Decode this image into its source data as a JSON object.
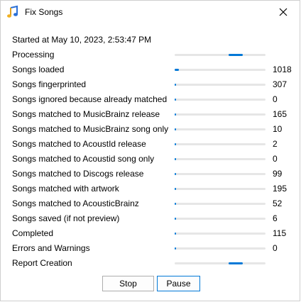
{
  "window": {
    "title": "Fix Songs",
    "accent": "#0078d7"
  },
  "started": "Started at May 10, 2023, 2:53:47 PM",
  "rows": [
    {
      "label": "Processing",
      "count": "",
      "marquee": true
    },
    {
      "label": "Songs loaded",
      "count": "1018",
      "progress": 0.05
    },
    {
      "label": "Songs fingerprinted",
      "count": "307",
      "progress": 0.015
    },
    {
      "label": "Songs ignored because already matched",
      "count": "0",
      "progress": 0
    },
    {
      "label": "Songs matched to MusicBrainz release",
      "count": "165",
      "progress": 0
    },
    {
      "label": "Songs matched to MusicBrainz song only",
      "count": "10",
      "progress": 0
    },
    {
      "label": "Songs matched to AcoustId release",
      "count": "2",
      "progress": 0
    },
    {
      "label": "Songs matched to Acoustid song only",
      "count": "0",
      "progress": 0
    },
    {
      "label": "Songs matched to Discogs release",
      "count": "99",
      "progress": 0
    },
    {
      "label": "Songs matched with artwork",
      "count": "195",
      "progress": 0
    },
    {
      "label": "Songs matched to AcousticBrainz",
      "count": "52",
      "progress": 0
    },
    {
      "label": "Songs saved (if not preview)",
      "count": "6",
      "progress": 0
    },
    {
      "label": "Completed",
      "count": "115",
      "progress": 0
    },
    {
      "label": "Errors and Warnings",
      "count": "0",
      "progress": 0
    },
    {
      "label": "Report Creation",
      "count": "",
      "marquee": true
    }
  ],
  "buttons": {
    "stop": "Stop",
    "pause": "Pause"
  }
}
